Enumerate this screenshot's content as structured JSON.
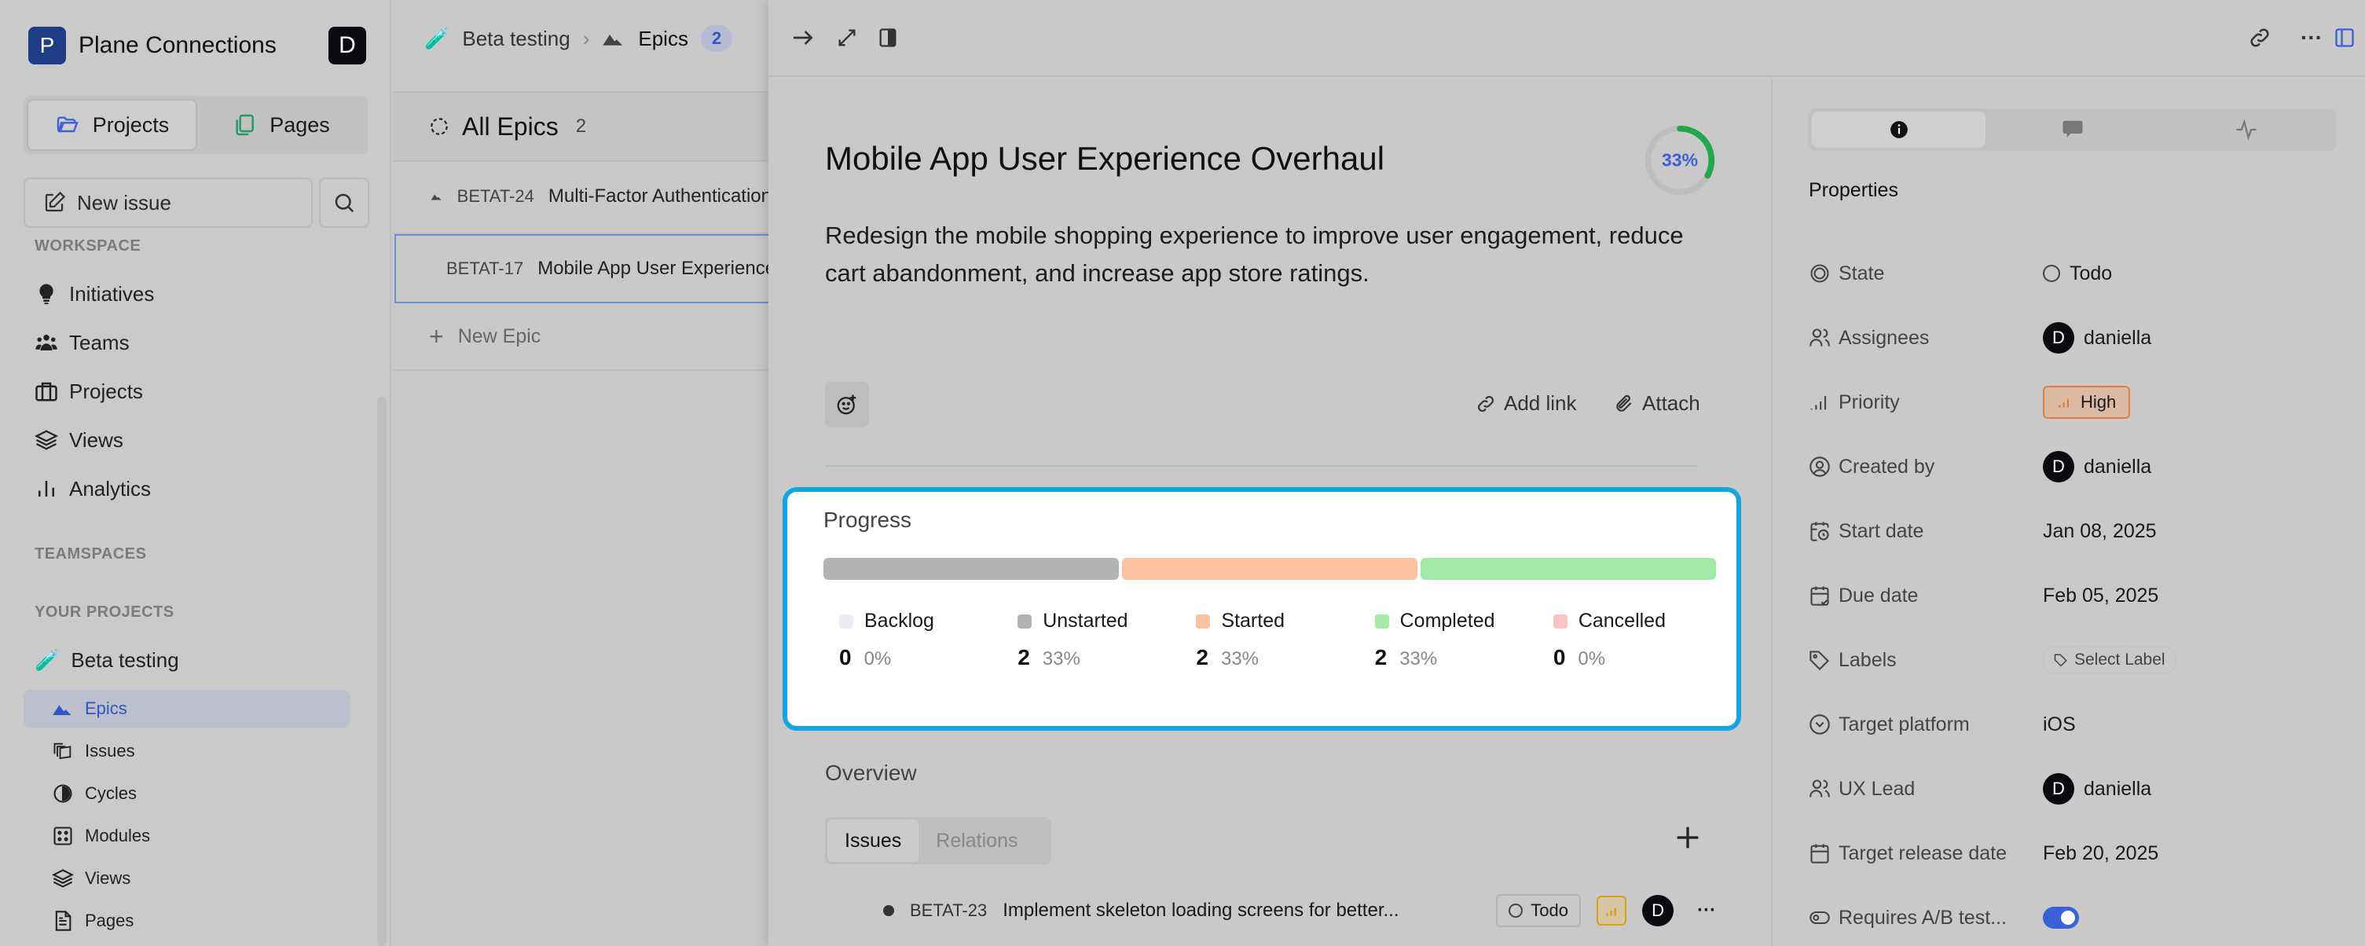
{
  "workspace": {
    "logo_letter": "P",
    "name": "Plane Connections",
    "user_initial": "D"
  },
  "sidebar": {
    "segments": [
      {
        "label": "Projects",
        "icon": "folder-icon",
        "active": true
      },
      {
        "label": "Pages",
        "icon": "pages-icon",
        "active": false
      }
    ],
    "new_issue_label": "New issue",
    "workspace_label": "WORKSPACE",
    "workspace_items": [
      {
        "label": "Initiatives",
        "icon": "lightbulb-icon"
      },
      {
        "label": "Teams",
        "icon": "teams-icon"
      },
      {
        "label": "Projects",
        "icon": "briefcase-icon"
      },
      {
        "label": "Views",
        "icon": "layers-icon"
      },
      {
        "label": "Analytics",
        "icon": "bar-chart-icon"
      }
    ],
    "teamspaces_label": "TEAMSPACES",
    "your_projects_label": "YOUR PROJECTS",
    "project": {
      "name": "Beta testing",
      "emoji": "🧪"
    },
    "project_items": [
      {
        "label": "Epics",
        "icon": "epic-icon",
        "active": true
      },
      {
        "label": "Issues",
        "icon": "issues-icon"
      },
      {
        "label": "Cycles",
        "icon": "cycle-icon"
      },
      {
        "label": "Modules",
        "icon": "modules-icon"
      },
      {
        "label": "Views",
        "icon": "layers-icon"
      },
      {
        "label": "Pages",
        "icon": "page-icon"
      }
    ]
  },
  "list": {
    "breadcrumb": {
      "project": "Beta testing",
      "section": "Epics",
      "count": "2"
    },
    "group_title": "All Epics",
    "group_count": "2",
    "epics": [
      {
        "id": "BETAT-24",
        "title": "Multi-Factor Authentication"
      },
      {
        "id": "BETAT-17",
        "title": "Mobile App User Experience Overhaul",
        "selected": true
      }
    ],
    "new_epic_label": "New Epic"
  },
  "epic": {
    "title": "Mobile App User Experience Overhaul",
    "progress_percent": 33,
    "progress_label": "33%",
    "description": "Redesign the mobile shopping experience to improve user engagement, reduce cart abandonment, and increase app store ratings.",
    "add_link_label": "Add link",
    "attach_label": "Attach",
    "progress": {
      "title": "Progress",
      "states": [
        {
          "name": "Backlog",
          "count": "0",
          "percent": "0%",
          "value": 0,
          "color": "#ececf1"
        },
        {
          "name": "Unstarted",
          "count": "2",
          "percent": "33%",
          "value": 2,
          "color": "#b4b4b4"
        },
        {
          "name": "Started",
          "count": "2",
          "percent": "33%",
          "value": 2,
          "color": "#fcc19e"
        },
        {
          "name": "Completed",
          "count": "2",
          "percent": "33%",
          "value": 2,
          "color": "#a3e9a7"
        },
        {
          "name": "Cancelled",
          "count": "0",
          "percent": "0%",
          "value": 0,
          "color": "#f8c4c4"
        }
      ]
    },
    "overview": {
      "title": "Overview",
      "tabs": [
        {
          "label": "Issues",
          "active": true
        },
        {
          "label": "Relations",
          "active": false
        }
      ],
      "issues": [
        {
          "id": "BETAT-23",
          "title": "Implement skeleton loading screens for better...",
          "state": "Todo",
          "assignee_initial": "D"
        }
      ]
    }
  },
  "properties": {
    "title": "Properties",
    "rows": [
      {
        "label": "State",
        "icon": "state-icon",
        "value": "Todo",
        "kind": "state"
      },
      {
        "label": "Assignees",
        "icon": "users-icon",
        "value": "daniella",
        "kind": "user"
      },
      {
        "label": "Priority",
        "icon": "priority-icon",
        "value": "High",
        "kind": "priority"
      },
      {
        "label": "Created by",
        "icon": "user-circle-icon",
        "value": "daniella",
        "kind": "user"
      },
      {
        "label": "Start date",
        "icon": "calendar-clock-icon",
        "value": "Jan 08, 2025",
        "kind": "text"
      },
      {
        "label": "Due date",
        "icon": "calendar-check-icon",
        "value": "Feb 05, 2025",
        "kind": "text"
      },
      {
        "label": "Labels",
        "icon": "tag-icon",
        "value": "Select Label",
        "kind": "label"
      },
      {
        "label": "Target platform",
        "icon": "chevron-circle-icon",
        "value": "iOS",
        "kind": "text"
      },
      {
        "label": "UX Lead",
        "icon": "users-icon",
        "value": "daniella",
        "kind": "user"
      },
      {
        "label": "Target release date",
        "icon": "calendar-icon",
        "value": "Feb 20, 2025",
        "kind": "text"
      },
      {
        "label": "Requires A/B test...",
        "icon": "toggle-icon",
        "value": "true",
        "kind": "toggle"
      }
    ],
    "user_initial": "D"
  },
  "colors": {
    "accent": "#3a62d6",
    "highlight": "#14a6e0",
    "progress_ring": "#1fa84c",
    "priority_high": "#e07f3d"
  }
}
